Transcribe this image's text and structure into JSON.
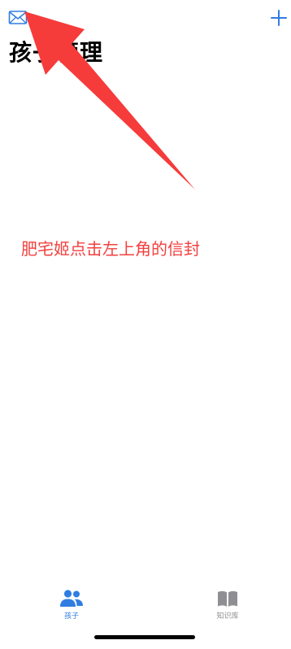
{
  "header": {
    "title": "孩子管理",
    "mail_icon": "envelope-icon",
    "add_icon": "plus-icon"
  },
  "annotation": {
    "text": "肥宅姬点击左上角的信封",
    "color": "#f2403f"
  },
  "tabbar": {
    "items": [
      {
        "label": "孩子",
        "icon": "people-icon",
        "active": true,
        "color": "#2f7de1"
      },
      {
        "label": "知识库",
        "icon": "book-icon",
        "active": false,
        "color": "#8e8e93"
      }
    ]
  },
  "colors": {
    "accent": "#2f7de1",
    "inactive": "#8e8e93",
    "arrow": "#f63b3b"
  }
}
